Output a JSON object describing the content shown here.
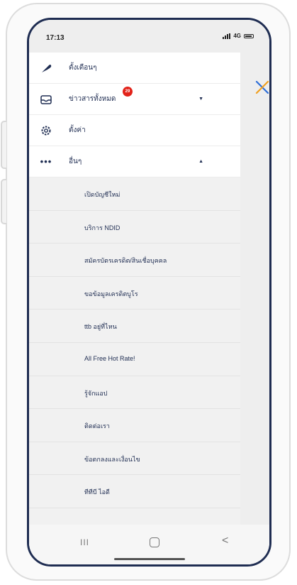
{
  "status_bar": {
    "time": "17:13",
    "network": "4G"
  },
  "menu": {
    "items": [
      {
        "label": "ตั้งเตือนๆ",
        "icon": "tool-icon",
        "top": 0
      },
      {
        "label": "ข่าวสารทั้งหมด",
        "icon": "inbox-icon",
        "badge": "29",
        "expand": "▼"
      },
      {
        "label": "ตั้งค่า",
        "icon": "gear-icon"
      },
      {
        "label": "อื่นๆ",
        "icon": "more-icon",
        "expand": "▲"
      }
    ],
    "sub_items": [
      "เปิดบัญชีใหม่",
      "บริการ NDID",
      "สมัครบัตรเครดิต/สินเชื่อบุคคล",
      "ขอข้อมูลเครดิตบูโร",
      "ttb อยู่ที่ไหน",
      "All Free Hot Rate!",
      "รู้จักแอป",
      "ติดต่อเรา",
      "ข้อตกลงและเงื่อนไข",
      "ทีทีบี ไอดี"
    ]
  },
  "close_icon": "close-icon",
  "nav_bar": {
    "recent": "III",
    "back": "<"
  },
  "colors": {
    "accent": "#1f2d52",
    "close": "#2f6fd8",
    "badge": "#e2231a"
  }
}
